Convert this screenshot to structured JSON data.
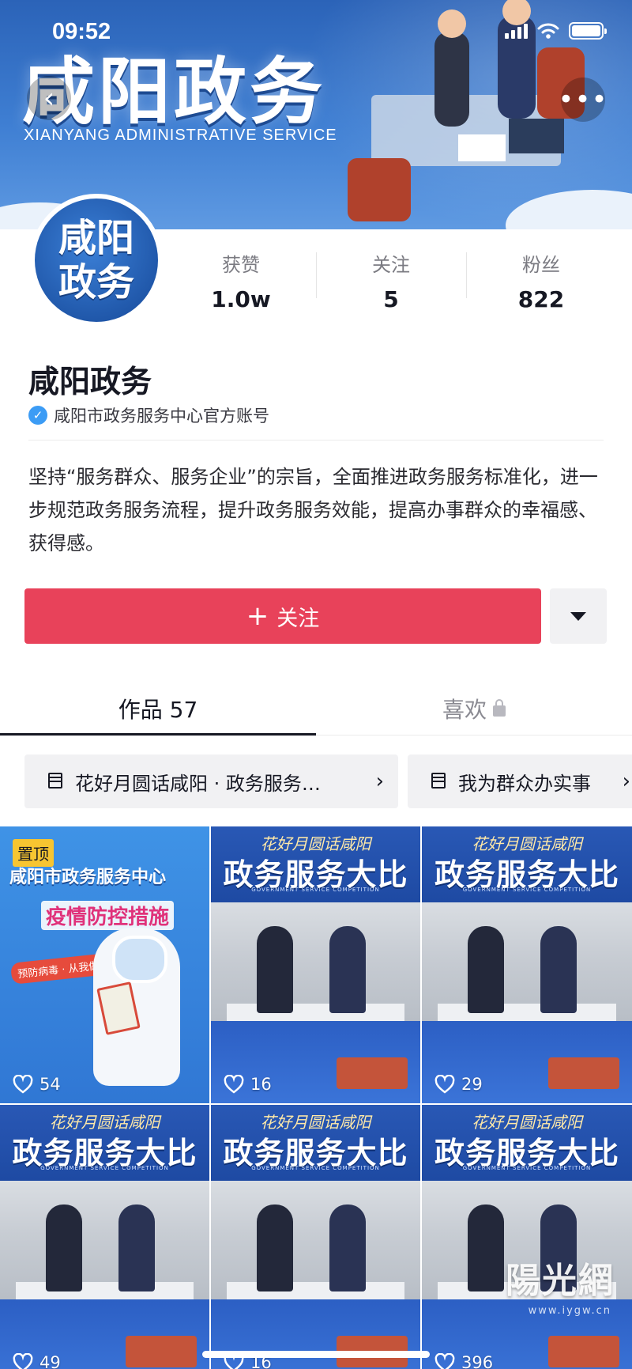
{
  "status_bar": {
    "time": "09:52"
  },
  "banner": {
    "title": "咸阳政务",
    "subtitle": "XIANYANG ADMINISTRATIVE SERVICE"
  },
  "avatar": {
    "line1": "咸阳",
    "line2": "政务"
  },
  "stats": [
    {
      "label": "获赞",
      "value": "1.0w"
    },
    {
      "label": "关注",
      "value": "5"
    },
    {
      "label": "粉丝",
      "value": "822"
    }
  ],
  "profile": {
    "name": "咸阳政务",
    "verification": "咸阳市政务服务中心官方账号",
    "bio": "坚持“服务群众、服务企业”的宗旨，全面推进政务服务标准化，进一步规范政务服务流程，提升政务服务效能，提高办事群众的幸福感、获得感。"
  },
  "actions": {
    "follow_label": "关注"
  },
  "tabs": [
    {
      "label": "作品 57"
    },
    {
      "label": "喜欢"
    }
  ],
  "collections": [
    {
      "label": "花好月圆话咸阳 · 政务服务…"
    },
    {
      "label": "我为群众办实事"
    }
  ],
  "videos": [
    {
      "pinned": "置顶",
      "headline": "咸阳市政务服务中心",
      "highlight": "疫情防控措施",
      "badge": "预防病毒 · 从我做起",
      "likes": "54"
    },
    {
      "header": "花好月圆话咸阳",
      "title": "政务服务大比武",
      "sub": "GOVERNMENT SERVICE COMPETITION",
      "likes": "16"
    },
    {
      "header": "花好月圆话咸阳",
      "title": "政务服务大比武",
      "sub": "GOVERNMENT SERVICE COMPETITION",
      "likes": "29"
    },
    {
      "header": "花好月圆话咸阳",
      "title": "政务服务大比武",
      "sub": "GOVERNMENT SERVICE COMPETITION",
      "likes": "49"
    },
    {
      "header": "花好月圆话咸阳",
      "title": "政务服务大比武",
      "sub": "GOVERNMENT SERVICE COMPETITION",
      "likes": "16"
    },
    {
      "header": "花好月圆话咸阳",
      "title": "政务服务大比武",
      "sub": "GOVERNMENT SERVICE COMPETITION",
      "likes": "396"
    }
  ],
  "watermark": {
    "text": "陽光網",
    "sub": "www.iygw.cn"
  },
  "colors": {
    "accent": "#e8425a",
    "banner": "#2b63b8",
    "verify": "#3c9cf5",
    "pin": "#f7c531"
  }
}
